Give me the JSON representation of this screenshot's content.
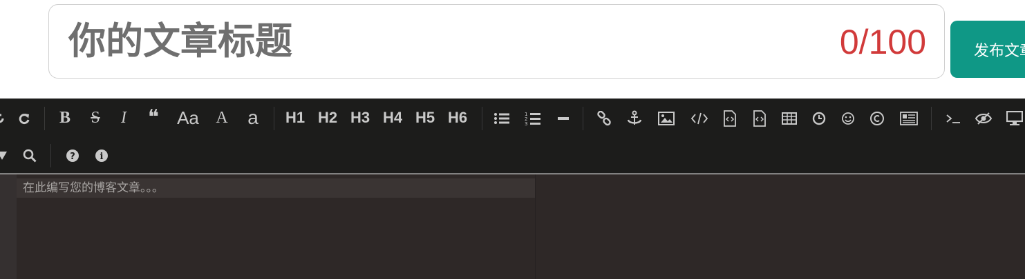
{
  "title": {
    "placeholder": "你的文章标题",
    "counter": "0/100"
  },
  "publish_button": {
    "label": "发布文章"
  },
  "toolbar": {
    "bold": "B",
    "strike": "S",
    "italic": "I",
    "quote": "❝",
    "uppercase": "Aa",
    "uppercase_first": "A",
    "lowercase": "a",
    "h1": "H1",
    "h2": "H2",
    "h3": "H3",
    "h4": "H4",
    "h5": "H5",
    "h6": "H6"
  },
  "icons": [
    "undo-icon",
    "redo-icon",
    "bold-icon",
    "strikethrough-icon",
    "italic-icon",
    "quote-icon",
    "uppercase-icon",
    "ucfirst-icon",
    "lowercase-icon",
    "unordered-list-icon",
    "ordered-list-icon",
    "horizontal-rule-icon",
    "link-icon",
    "anchor-icon",
    "image-icon",
    "code-icon",
    "code-block-icon",
    "preformatted-icon",
    "table-icon",
    "datetime-icon",
    "emoji-icon",
    "html-entities-icon",
    "pagebreak-icon",
    "goto-line-icon",
    "unwatch-icon",
    "preview-icon",
    "fullscreen-icon",
    "search-icon",
    "help-icon",
    "info-icon"
  ],
  "editor": {
    "placeholder": "在此编写您的博客文章。。。"
  },
  "colors": {
    "accent": "#0f9886",
    "counter": "#d13a3a",
    "toolbar_bg": "#1c1c1b",
    "editor_bg": "#2e2827"
  }
}
